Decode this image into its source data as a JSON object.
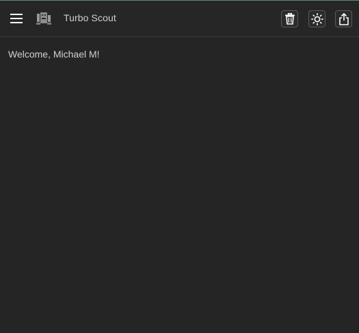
{
  "header": {
    "title": "Turbo Scout",
    "menu_icon": "hamburger-menu-icon",
    "logo_icon": "robot-logo-icon",
    "actions": [
      {
        "name": "delete",
        "icon": "trash-icon"
      },
      {
        "name": "theme-toggle",
        "icon": "sun-icon"
      },
      {
        "name": "share",
        "icon": "share-icon"
      }
    ]
  },
  "main": {
    "welcome_text": "Welcome, Michael M!"
  },
  "colors": {
    "background": "#252525",
    "text": "#d0d0d0",
    "accent_line": "#4f8f6f"
  }
}
